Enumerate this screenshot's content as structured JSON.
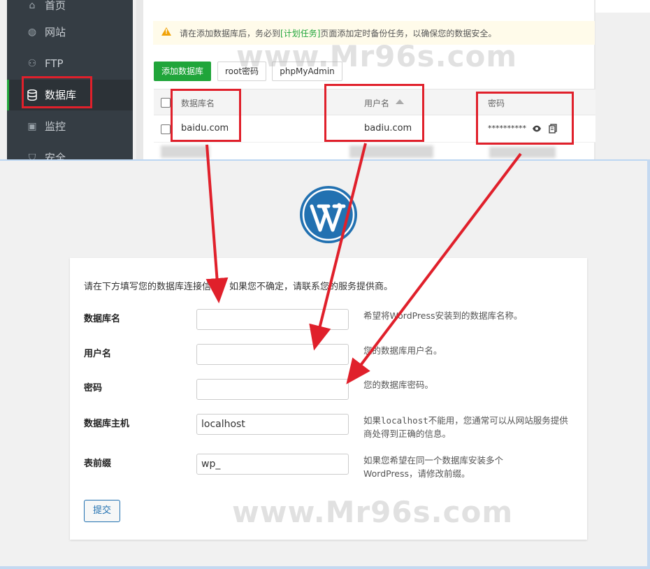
{
  "panel": {
    "sidebar": [
      {
        "label": "首页",
        "icon": "home-icon"
      },
      {
        "label": "网站",
        "icon": "globe-icon"
      },
      {
        "label": "FTP",
        "icon": "ftp-icon"
      },
      {
        "label": "数据库",
        "icon": "database-icon",
        "active": true
      },
      {
        "label": "监控",
        "icon": "monitor-icon"
      },
      {
        "label": "安全",
        "icon": "shield-icon"
      }
    ],
    "notice": {
      "prefix": "请在添加数据库后，务必到",
      "link": "[计划任务]",
      "suffix": "页面添加定时备份任务，以确保您的数据安全。"
    },
    "buttons": {
      "add_db": "添加数据库",
      "root_pwd": "root密码",
      "phpmyadmin": "phpMyAdmin"
    },
    "table": {
      "headers": {
        "name": "数据库名",
        "user": "用户名",
        "password": "密码"
      },
      "row": {
        "name": "baidu.com",
        "user": "badiu.com",
        "password": "**********"
      }
    },
    "accent_color": "#20a53a"
  },
  "watermark": "www.Mr96s.com",
  "wp": {
    "intro": "请在下方填写您的数据库连接信息。如果您不确定，请联系您的服务提供商。",
    "fields": [
      {
        "label": "数据库名",
        "value": "",
        "hint": "希望将WordPress安装到的数据库名称。"
      },
      {
        "label": "用户名",
        "value": "",
        "hint": "您的数据库用户名。"
      },
      {
        "label": "密码",
        "value": "",
        "hint": "您的数据库密码。"
      },
      {
        "label": "数据库主机",
        "value": "localhost",
        "hint_pre": "如果",
        "hint_code": "localhost",
        "hint_post": "不能用，您通常可以从网站服务提供商处得到正确的信息。"
      },
      {
        "label": "表前缀",
        "value": "wp_",
        "hint": "如果您希望在同一个数据库安装多个WordPress，请修改前缀。"
      }
    ],
    "submit": "提交"
  },
  "annotation_color": "#e0202b"
}
